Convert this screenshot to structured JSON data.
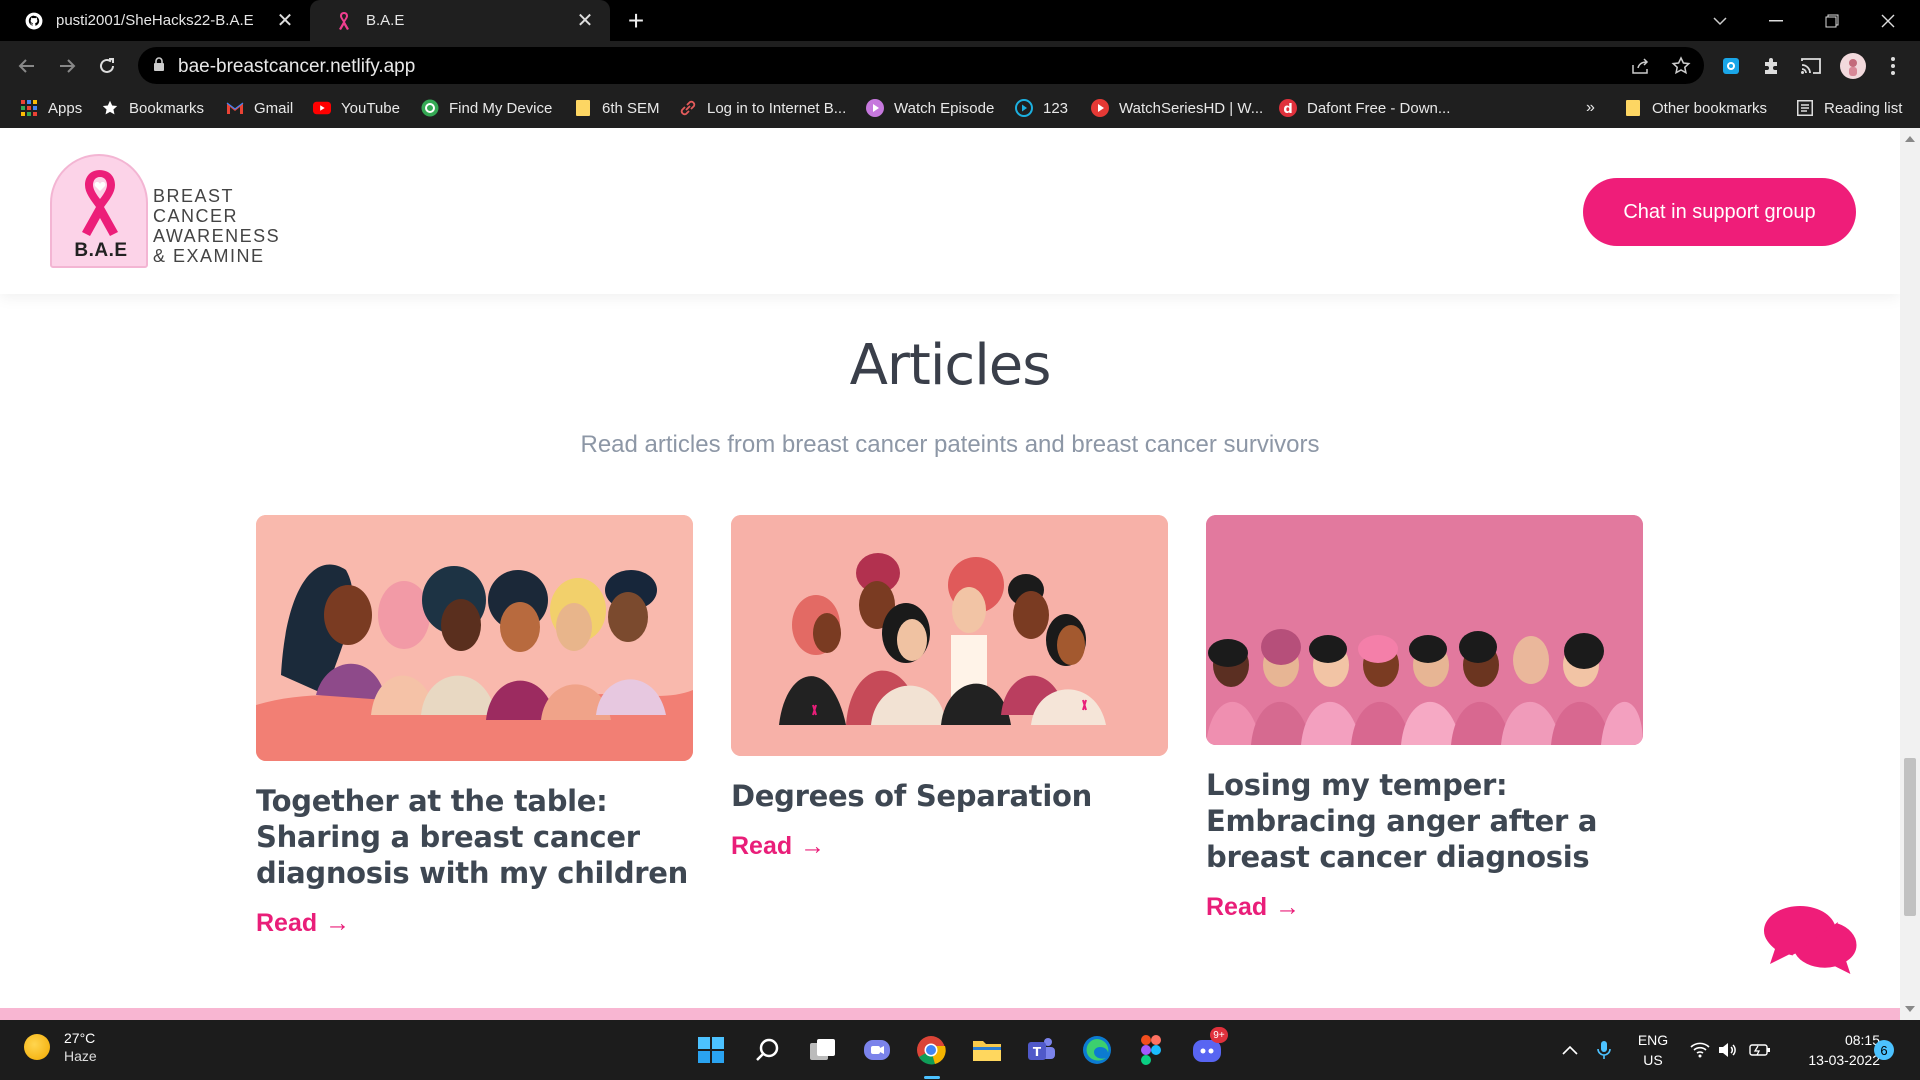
{
  "browser": {
    "tabs": [
      {
        "title": "pusti2001/SheHacks22-B.A.E",
        "icon": "github-icon",
        "active": false
      },
      {
        "title": "B.A.E",
        "icon": "pink-ribbon-icon",
        "active": true
      }
    ],
    "close_glyph": "✕",
    "new_tab_glyph": "+",
    "url": "bae-breastcancer.netlify.app"
  },
  "bookmarks": {
    "items": [
      {
        "label": "Apps",
        "icon": "apps-grid-icon"
      },
      {
        "label": "Bookmarks",
        "icon": "star-icon"
      },
      {
        "label": "Gmail",
        "icon": "gmail-icon"
      },
      {
        "label": "YouTube",
        "icon": "youtube-icon"
      },
      {
        "label": "Find My Device",
        "icon": "find-device-icon"
      },
      {
        "label": "6th SEM",
        "icon": "folder-icon"
      },
      {
        "label": "Log in to Internet B...",
        "icon": "link-icon"
      },
      {
        "label": "Watch Episode",
        "icon": "play-icon"
      },
      {
        "label": "123",
        "icon": "play-circle-icon"
      },
      {
        "label": "WatchSeriesHD | W...",
        "icon": "play-red-icon"
      },
      {
        "label": "Dafont Free - Down...",
        "icon": "dafont-icon"
      }
    ],
    "overflow": "»",
    "other": "Other bookmarks",
    "reading_list": "Reading list"
  },
  "site": {
    "logo_badge": "B.A.E",
    "logo_lines": [
      "BREAST",
      "CANCER",
      "AWARENESS",
      "& EXAMINE"
    ],
    "chat_button": "Chat in support group",
    "section_title": "Articles",
    "section_subtitle": "Read articles from breast cancer pateints and breast cancer survivors",
    "read_label": "Read",
    "read_arrow": "→",
    "articles": [
      {
        "title": "Together at the table: Sharing a breast cancer diagnosis with my children"
      },
      {
        "title": "Degrees of Separation"
      },
      {
        "title": "Losing my temper: Embracing anger after a breast cancer diagnosis"
      }
    ],
    "accent_color": "#ef1d79"
  },
  "taskbar": {
    "weather_temp": "27°C",
    "weather_desc": "Haze",
    "lang_1": "ENG",
    "lang_2": "US",
    "time": "08:15",
    "date": "13-03-2022",
    "notification_count": "6",
    "discord_badge": "9+"
  }
}
